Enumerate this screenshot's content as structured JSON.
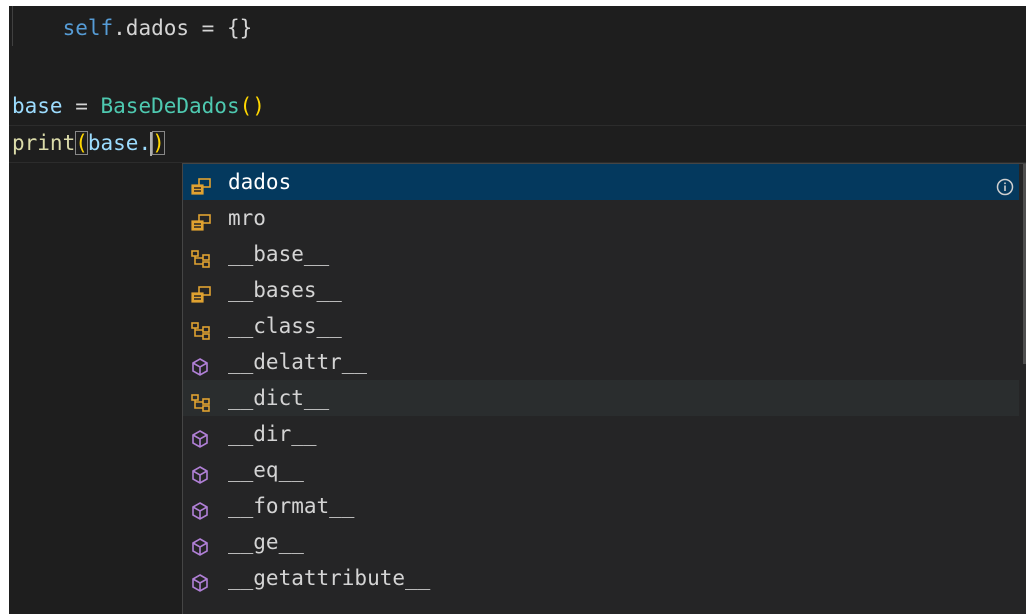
{
  "editor": {
    "lines": [
      {
        "indent": "    ",
        "self": "self",
        "rest": ".dados = {}"
      },
      {
        "text": ""
      },
      {
        "var": "base",
        "eq": " = ",
        "cls": "BaseDeDados",
        "paren": "()"
      },
      {
        "fn": "print",
        "open": "(",
        "arg": "base.",
        "close": ")"
      }
    ]
  },
  "suggest": {
    "items": [
      {
        "label": "dados",
        "kind": "field",
        "selected": true
      },
      {
        "label": "mro",
        "kind": "field"
      },
      {
        "label": "__base__",
        "kind": "class"
      },
      {
        "label": "__bases__",
        "kind": "field"
      },
      {
        "label": "__class__",
        "kind": "class"
      },
      {
        "label": "__delattr__",
        "kind": "method"
      },
      {
        "label": "__dict__",
        "kind": "class",
        "hover": true
      },
      {
        "label": "__dir__",
        "kind": "method"
      },
      {
        "label": "__eq__",
        "kind": "method"
      },
      {
        "label": "__format__",
        "kind": "method"
      },
      {
        "label": "__ge__",
        "kind": "method"
      },
      {
        "label": "__getattribute__",
        "kind": "method"
      }
    ],
    "colors": {
      "field": "#e0a230",
      "class": "#e0a230",
      "method": "#b180d7",
      "selected_bg": "#04395e"
    }
  }
}
